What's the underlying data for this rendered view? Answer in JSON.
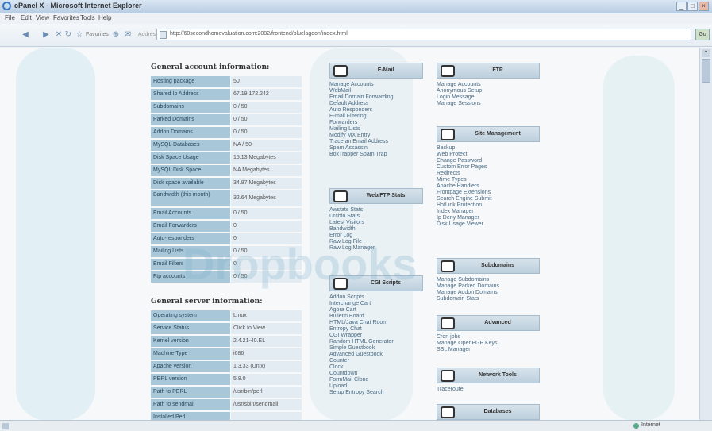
{
  "window": {
    "title": "cPanel X - Microsoft Internet Explorer"
  },
  "menu": [
    "File",
    "Edit",
    "View",
    "Favorites",
    "Tools",
    "Help"
  ],
  "toolbar": {
    "favorites_label": "Favorites",
    "address_label": "Address",
    "url": "http://60secondhomevaluation.com:2082/frontend/bluelagoon/index.html",
    "go_label": "Go"
  },
  "account": {
    "title": "General account information:",
    "rows": [
      {
        "label": "Hosting package",
        "value": "50"
      },
      {
        "label": "Shared Ip Address",
        "value": "67.19.172.242"
      },
      {
        "label": "Subdomains",
        "value": "0 / 50"
      },
      {
        "label": "Parked Domains",
        "value": "0 / 50"
      },
      {
        "label": "Addon Domains",
        "value": "0 / 50"
      },
      {
        "label": "MySQL Databases",
        "value": "NA / 50"
      },
      {
        "label": "Disk Space Usage",
        "value": "15.13 Megabytes"
      },
      {
        "label": "MySQL Disk Space",
        "value": "NA Megabytes"
      },
      {
        "label": "Disk space available",
        "value": "34.87 Megabytes"
      },
      {
        "label": "Bandwidth (this month)",
        "value": "32.64 Megabytes"
      },
      {
        "label": "Email Accounts",
        "value": "0 / 50"
      },
      {
        "label": "Email Forwarders",
        "value": "0"
      },
      {
        "label": "Auto-responders",
        "value": "0"
      },
      {
        "label": "Mailing Lists",
        "value": "0 / 50"
      },
      {
        "label": "Email Filters",
        "value": "0"
      },
      {
        "label": "Ftp accounts",
        "value": "0 / 50"
      }
    ]
  },
  "server": {
    "title": "General server information:",
    "rows": [
      {
        "label": "Operating system",
        "value": "Linux"
      },
      {
        "label": "Service Status",
        "value": "Click to View"
      },
      {
        "label": "Kernel version",
        "value": "2.4.21-40.EL"
      },
      {
        "label": "Machine Type",
        "value": "i686"
      },
      {
        "label": "Apache version",
        "value": "1.3.33 (Unix)"
      },
      {
        "label": "PERL version",
        "value": "5.8.0"
      },
      {
        "label": "Path to PERL",
        "value": "/usr/bin/perl"
      },
      {
        "label": "Path to sendmail",
        "value": "/usr/sbin/sendmail"
      },
      {
        "label": "Installed Perl",
        "value": ""
      }
    ]
  },
  "panels": {
    "email": {
      "title": "E-Mail",
      "links": [
        "Manage Accounts",
        "WebMail",
        "Email Domain Forwarding",
        "Default Address",
        "Auto Responders",
        "E-mail Filtering",
        "Forwarders",
        "Mailing Lists",
        "Modify MX Entry",
        "Trace an Email Address",
        "Spam Assassin",
        "BoxTrapper Spam Trap"
      ]
    },
    "stats": {
      "title": "Web/FTP Stats",
      "links": [
        "Awstats Stats",
        "Urchin Stats",
        "Latest Visitors",
        "Bandwidth",
        "Error Log",
        "Raw Log File",
        "Raw Log Manager"
      ]
    },
    "cgi": {
      "title": "CGI Scripts",
      "links": [
        "Addon Scripts",
        "Interchange Cart",
        "Agora Cart",
        "Bulletin Board",
        "HTML/Java Chat Room",
        "Entropy Chat",
        "CGI Wrapper",
        "Random HTML Generator",
        "Simple Guestbook",
        "Advanced Guestbook",
        "Counter",
        "Clock",
        "Countdown",
        "FormMail Clone",
        "Upload",
        "Setup Entropy Search"
      ]
    },
    "ftp": {
      "title": "FTP",
      "links": [
        "Manage Accounts",
        "Anonymous Setup",
        "Login Message",
        "Manage Sessions"
      ]
    },
    "site": {
      "title": "Site Management",
      "links": [
        "Backup",
        "Web Protect",
        "Change Password",
        "Custom Error Pages",
        "Redirects",
        "Mime Types",
        "Apache Handlers",
        "Frontpage Extensions",
        "Search Engine Submit",
        "HotLink Protection",
        "Index Manager",
        "Ip Deny Manager",
        "Disk Usage Viewer"
      ]
    },
    "sub": {
      "title": "Subdomains",
      "links": [
        "Manage Subdomains",
        "Manage Parked Domains",
        "Manage Addon Domains",
        "Subdomain Stats"
      ]
    },
    "adv": {
      "title": "Advanced",
      "links": [
        "Cron jobs",
        "Manage OpenPGP Keys",
        "SSL Manager"
      ]
    },
    "net": {
      "title": "Network Tools",
      "links": [
        "Traceroute"
      ]
    },
    "db": {
      "title": "Databases",
      "links": []
    }
  },
  "watermark": "Dropbooks",
  "status": {
    "zone": "Internet"
  }
}
